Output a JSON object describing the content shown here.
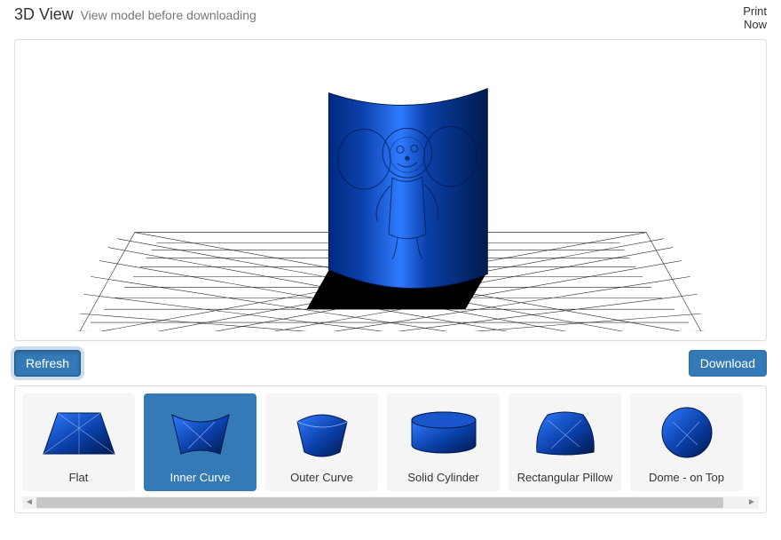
{
  "header": {
    "title_bold": "3D View",
    "title_rest": "View model before downloading",
    "print_now_line1": "Print",
    "print_now_line2": "Now"
  },
  "actions": {
    "refresh_label": "Refresh",
    "download_label": "Download"
  },
  "shapes": [
    {
      "label": "Flat",
      "active": false,
      "icon": "flat"
    },
    {
      "label": "Inner Curve",
      "active": true,
      "icon": "inner-curve"
    },
    {
      "label": "Outer Curve",
      "active": false,
      "icon": "outer-curve"
    },
    {
      "label": "Solid Cylinder",
      "active": false,
      "icon": "solid-cylinder"
    },
    {
      "label": "Rectangular Pillow",
      "active": false,
      "icon": "rectangular-pillow"
    },
    {
      "label": "Dome - on Top",
      "active": false,
      "icon": "dome-on-top"
    }
  ],
  "colors": {
    "accent": "#337ab7",
    "model_dark": "#001a4d",
    "model_light": "#1a6bff"
  }
}
